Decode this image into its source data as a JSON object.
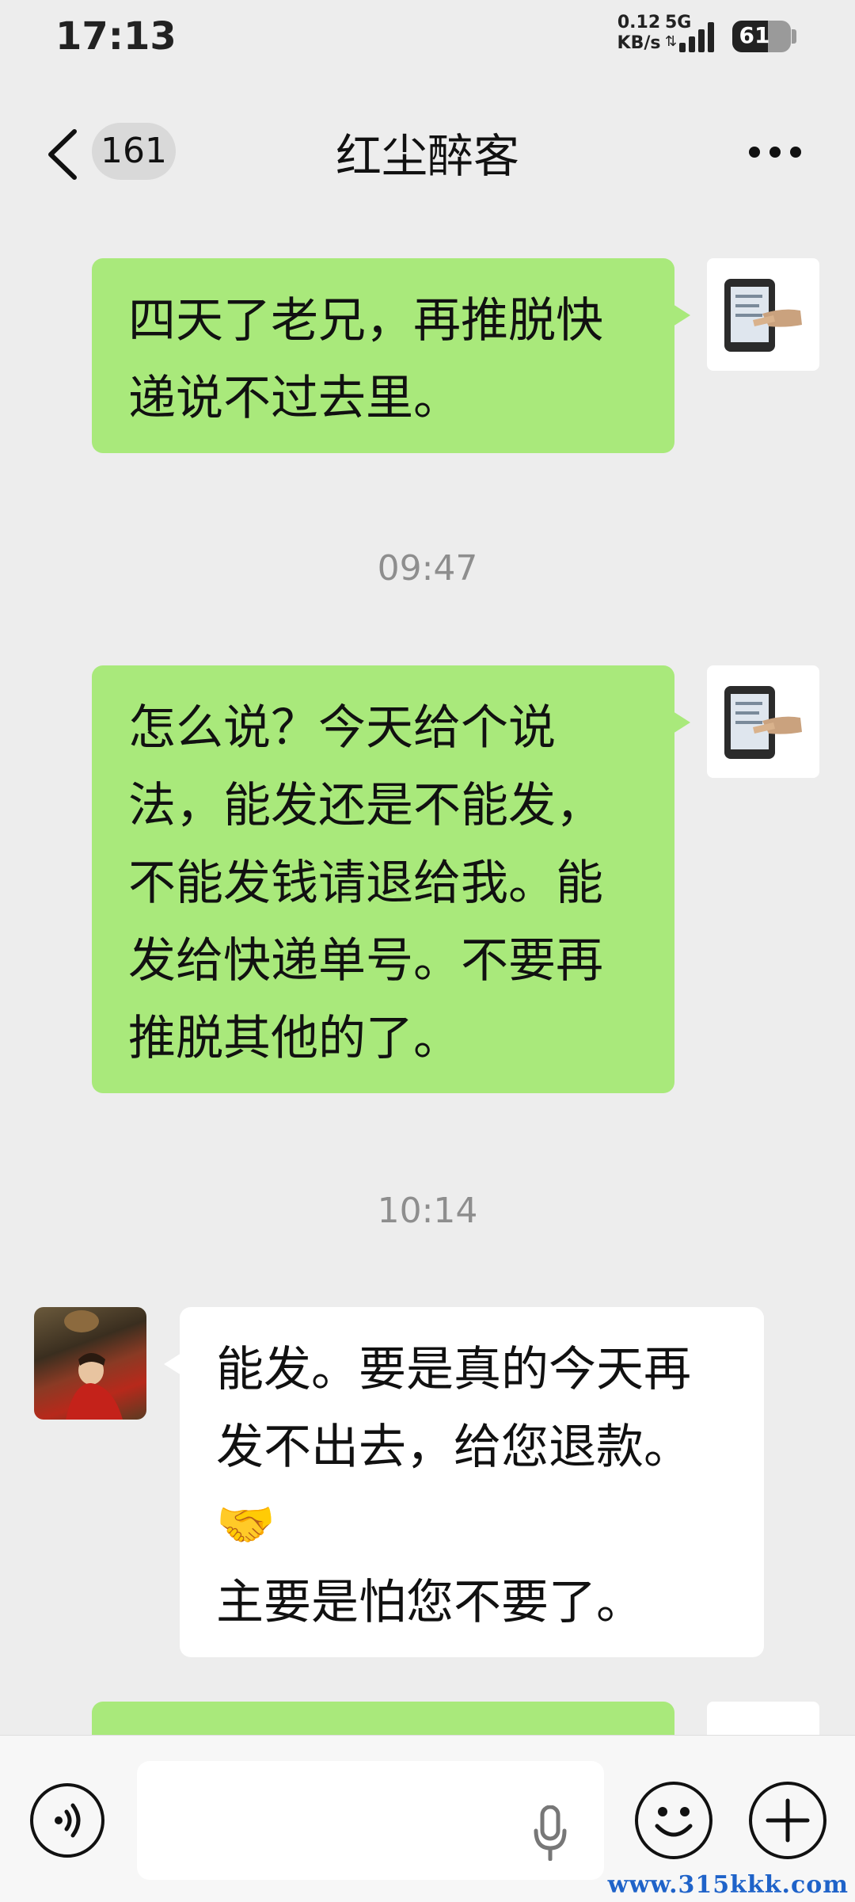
{
  "status_bar": {
    "time": "17:13",
    "net_speed_value": "0.12",
    "net_speed_unit": "KB/s",
    "network": "5G",
    "battery": "61",
    "battery_level": 0.61
  },
  "header": {
    "back_icon": "chevron-left-icon",
    "unread_count": "161",
    "title": "红尘醉客",
    "more_icon": "more-horizontal-icon"
  },
  "messages": [
    {
      "type": "outgoing",
      "lines": [
        "四天了老兄，再推脱快",
        "递说不过去里。"
      ]
    },
    {
      "type": "timestamp",
      "text": "09:47"
    },
    {
      "type": "outgoing",
      "lines": [
        "怎么说？今天给个说",
        "法，能发还是不能发，",
        "不能发钱请退给我。能",
        "发给快递单号。不要再",
        "推脱其他的了。"
      ]
    },
    {
      "type": "timestamp",
      "text": "10:14"
    },
    {
      "type": "incoming",
      "lines": [
        "能发。要是真的今天再",
        "发不出去，给您退款。",
        "🤝",
        "主要是怕您不要了。"
      ]
    }
  ],
  "input_bar": {
    "voice_icon": "voice-icon",
    "mic_icon": "microphone-icon",
    "emoji_icon": "emoji-icon",
    "plus_icon": "plus-icon",
    "text_value": ""
  },
  "watermark": "www.315kkk.com",
  "colors": {
    "background": "#ededed",
    "outgoing_bubble": "#a9e97b",
    "incoming_bubble": "#ffffff",
    "watermark": "#1f63c9"
  }
}
